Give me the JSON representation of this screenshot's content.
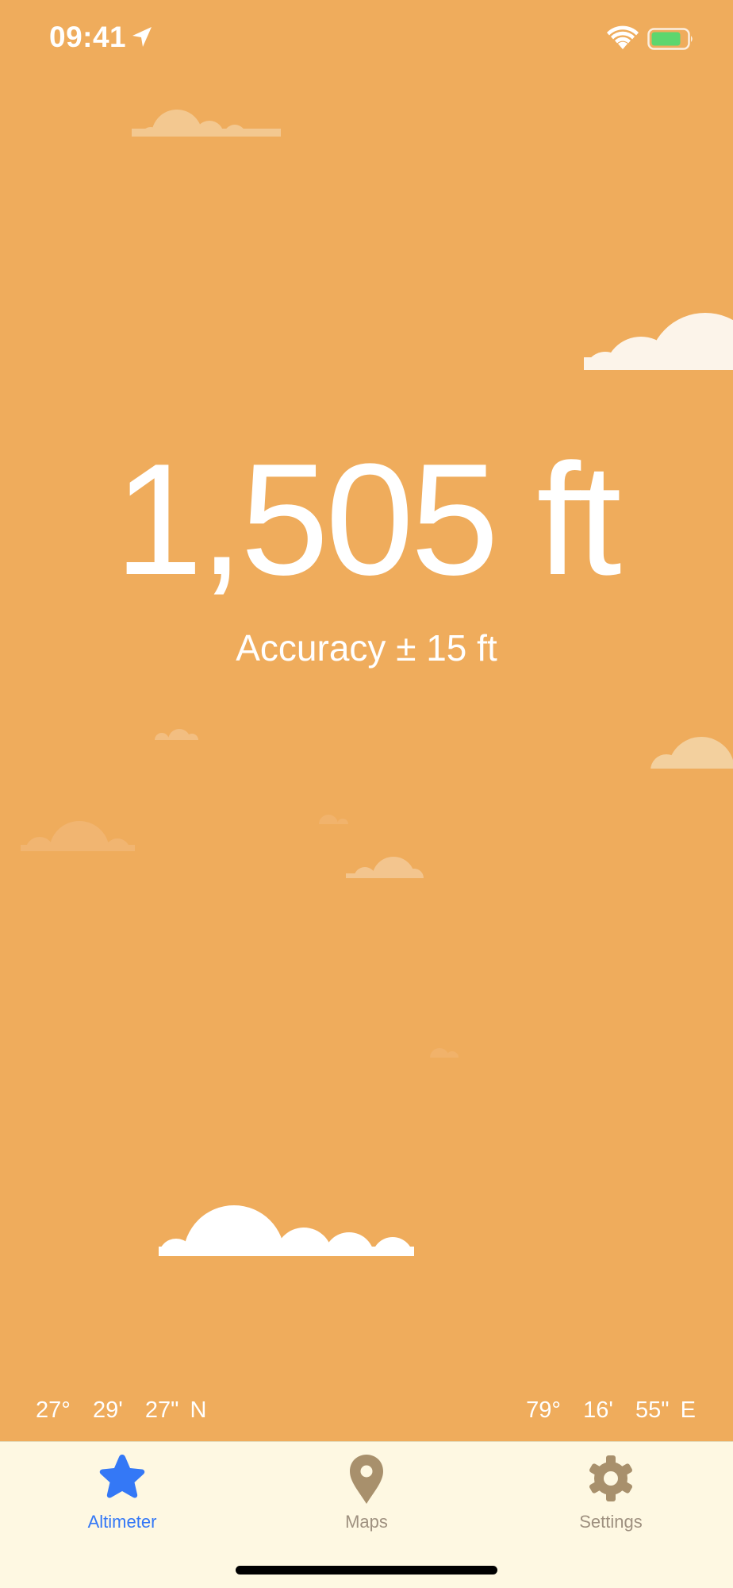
{
  "status_bar": {
    "time": "09:41"
  },
  "altitude": {
    "value": "1,505 ft"
  },
  "accuracy": {
    "text": "Accuracy ± 15 ft"
  },
  "coordinates": {
    "latitude": "27°  29'  27\" N",
    "longitude": "79°  16'  55\" E"
  },
  "tabs": [
    {
      "label": "Altimeter",
      "icon": "star-icon",
      "selected": true
    },
    {
      "label": "Maps",
      "icon": "map-pin-icon",
      "selected": false
    },
    {
      "label": "Settings",
      "icon": "gear-icon",
      "selected": false
    }
  ],
  "colors": {
    "background": "#EFAC5C",
    "tab_bar": "#FEF8E2",
    "accent": "#3478F6",
    "inactive_tab": "#9F9180",
    "battery": "#5DD66E"
  }
}
